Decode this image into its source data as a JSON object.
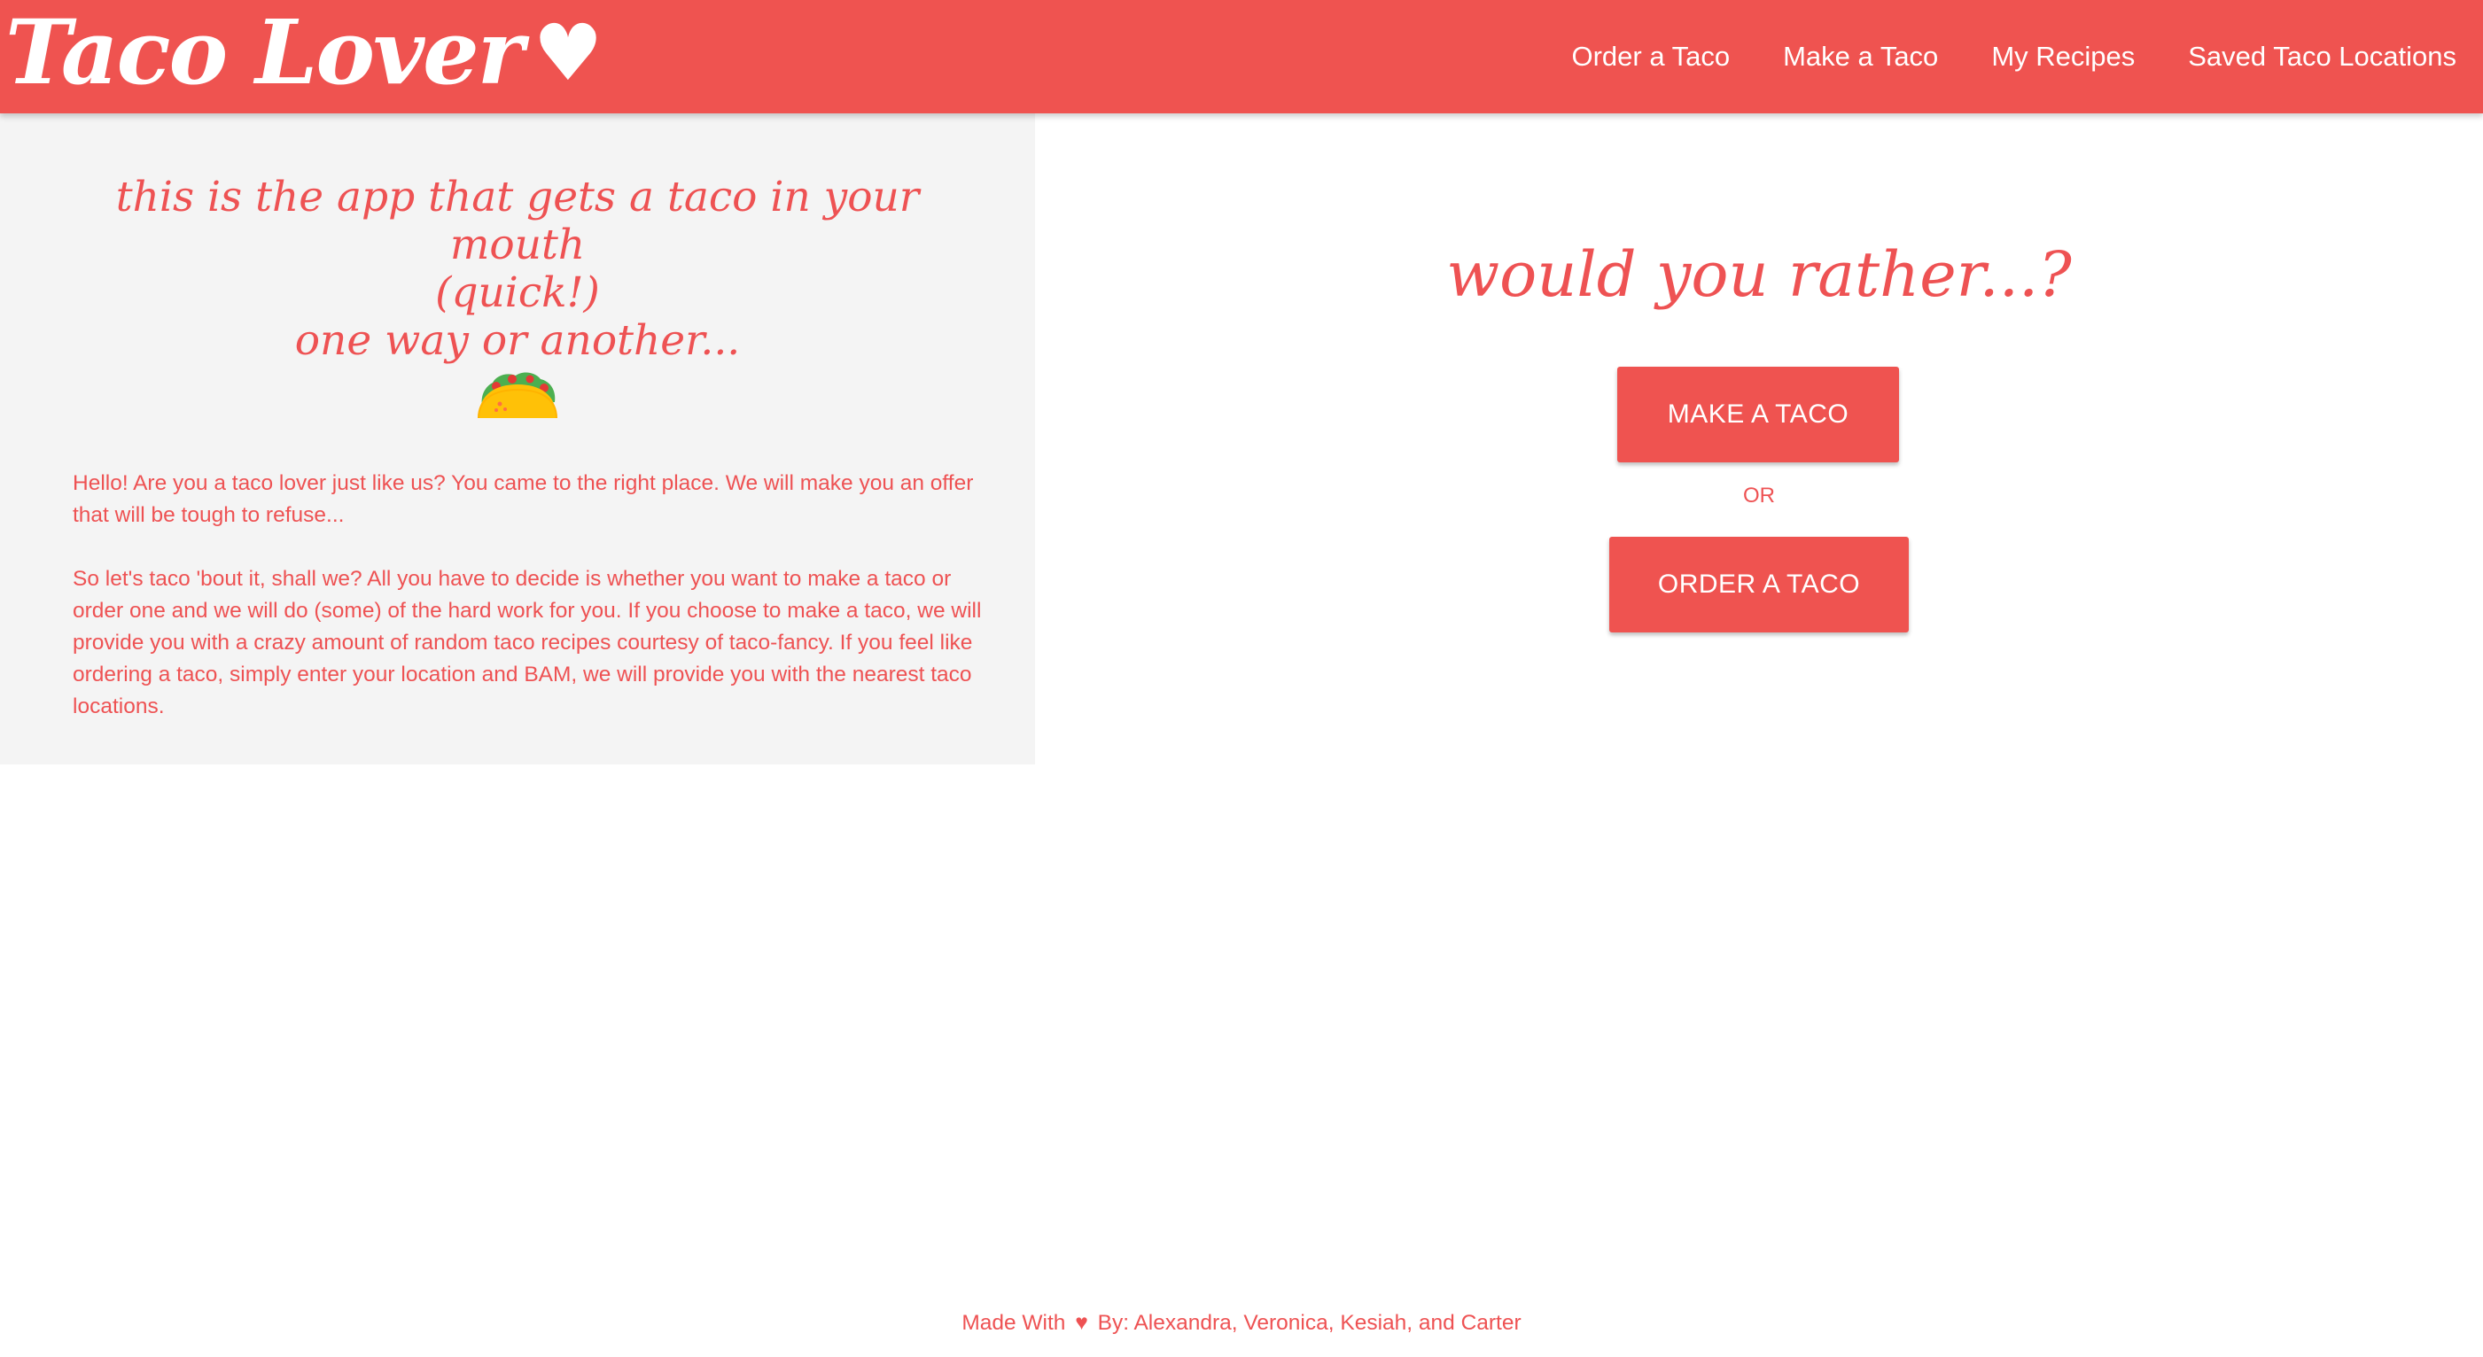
{
  "header": {
    "brand": "Taco Lover",
    "brand_icon": "heart-icon",
    "nav": [
      {
        "label": "Order a Taco"
      },
      {
        "label": "Make a Taco"
      },
      {
        "label": "My Recipes"
      },
      {
        "label": "Saved Taco Locations"
      }
    ]
  },
  "intro": {
    "tagline_line1": "this is the app that gets a taco in your mouth",
    "tagline_line2": "(quick!)",
    "tagline_line3": "one way or another...",
    "icon": "taco-icon",
    "paragraph1": "Hello! Are you a taco lover just like us? You came to the right place. We will make you an offer that will be tough to refuse...",
    "paragraph2": "So let's taco 'bout it, shall we? All you have to decide is whether you want to make a taco or order one and we will do (some) of the hard work for you. If you choose to make a taco, we will provide you with a crazy amount of random taco recipes courtesy of taco-fancy. If you feel like ordering a taco, simply enter your location and BAM, we will provide you with the nearest taco locations."
  },
  "choice": {
    "title": "would you rather...?",
    "make_button": "MAKE A TACO",
    "or_text": "OR",
    "order_button": "ORDER A TACO"
  },
  "footer": {
    "made_with": "Made With",
    "heart_icon": "heart-icon",
    "credits": "By: Alexandra, Veronica, Kesiah, and Carter"
  },
  "colors": {
    "accent": "#ef5350",
    "panel_bg": "#f4f4f4",
    "text_accent": "#ee5253"
  }
}
